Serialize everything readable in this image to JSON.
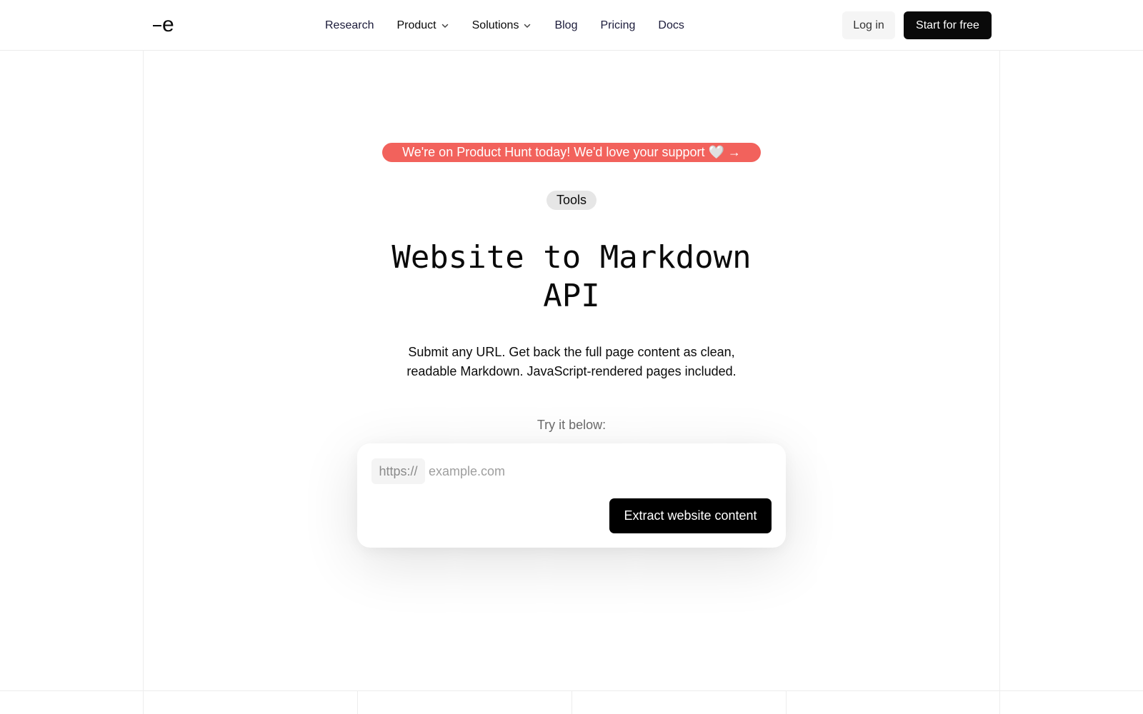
{
  "header": {
    "logo_text": "e",
    "nav": {
      "research": "Research",
      "product": "Product",
      "solutions": "Solutions",
      "blog": "Blog",
      "pricing": "Pricing",
      "docs": "Docs"
    },
    "login_label": "Log in",
    "start_label": "Start for free"
  },
  "hero": {
    "banner": "We're on Product Hunt today! We'd love your support 🤍 →",
    "tag": "Tools",
    "title_line1": "Website to Markdown",
    "title_line2": "API",
    "subtitle_line1": "Submit any URL. Get back the full page content as clean,",
    "subtitle_line2": "readable Markdown. JavaScript-rendered pages included.",
    "try_label": "Try it below:"
  },
  "extractor": {
    "prefix": "https://",
    "placeholder": "example.com",
    "value": "",
    "button_label": "Extract website content"
  },
  "colors": {
    "banner": "#f2625c",
    "primary_button": "#0a0a0a"
  },
  "icons": [
    "chevron-down-icon"
  ]
}
